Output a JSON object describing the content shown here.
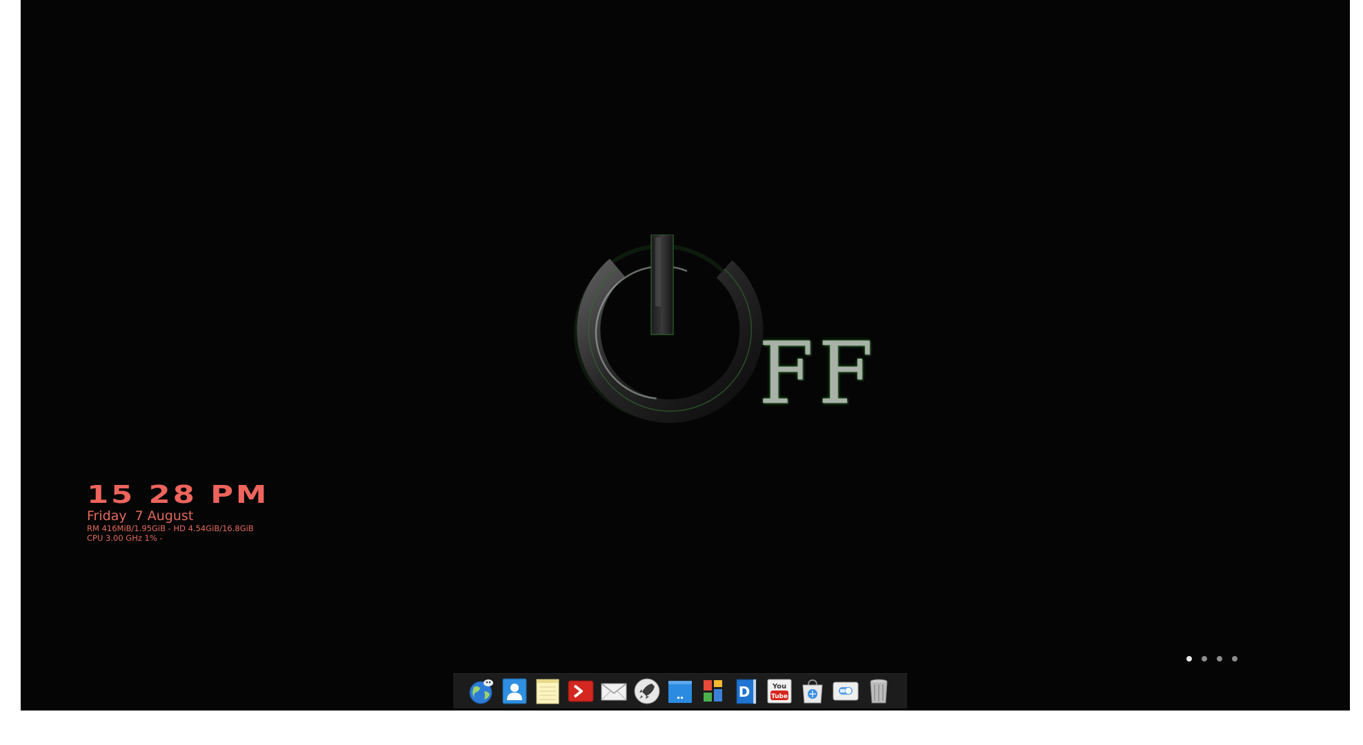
{
  "wallpaper": {
    "logo_icon": "power-icon",
    "logo_text": "FF",
    "accent_color": "#3d9a3d"
  },
  "widget": {
    "time": "15 28 PM",
    "date": "Friday  7 August",
    "memory_line": "RM 416MiB/1.95GiB - HD 4.54GiB/16.8GiB",
    "cpu_line": "CPU 3.00 GHz 1% -",
    "color": "#e36a5e"
  },
  "pager": {
    "workspaces": 4,
    "active_index": 0
  },
  "dock": {
    "items": [
      {
        "name": "web-browser",
        "icon": "globe-icon"
      },
      {
        "name": "contacts",
        "icon": "contacts-icon"
      },
      {
        "name": "notes",
        "icon": "notes-icon"
      },
      {
        "name": "terminal",
        "icon": "terminal-icon"
      },
      {
        "name": "mail",
        "icon": "mail-icon"
      },
      {
        "name": "launcher",
        "icon": "rocket-icon"
      },
      {
        "name": "show-desktop",
        "icon": "desktop-icon"
      },
      {
        "name": "app-grid",
        "icon": "tiles-icon"
      },
      {
        "name": "dictionary",
        "icon": "dictionary-icon"
      },
      {
        "name": "youtube",
        "icon": "youtube-icon",
        "label_top": "You",
        "label_bottom": "Tube"
      },
      {
        "name": "software-store",
        "icon": "store-bag-icon"
      },
      {
        "name": "settings",
        "icon": "switch-icon"
      },
      {
        "name": "trash",
        "icon": "trash-icon"
      }
    ]
  }
}
